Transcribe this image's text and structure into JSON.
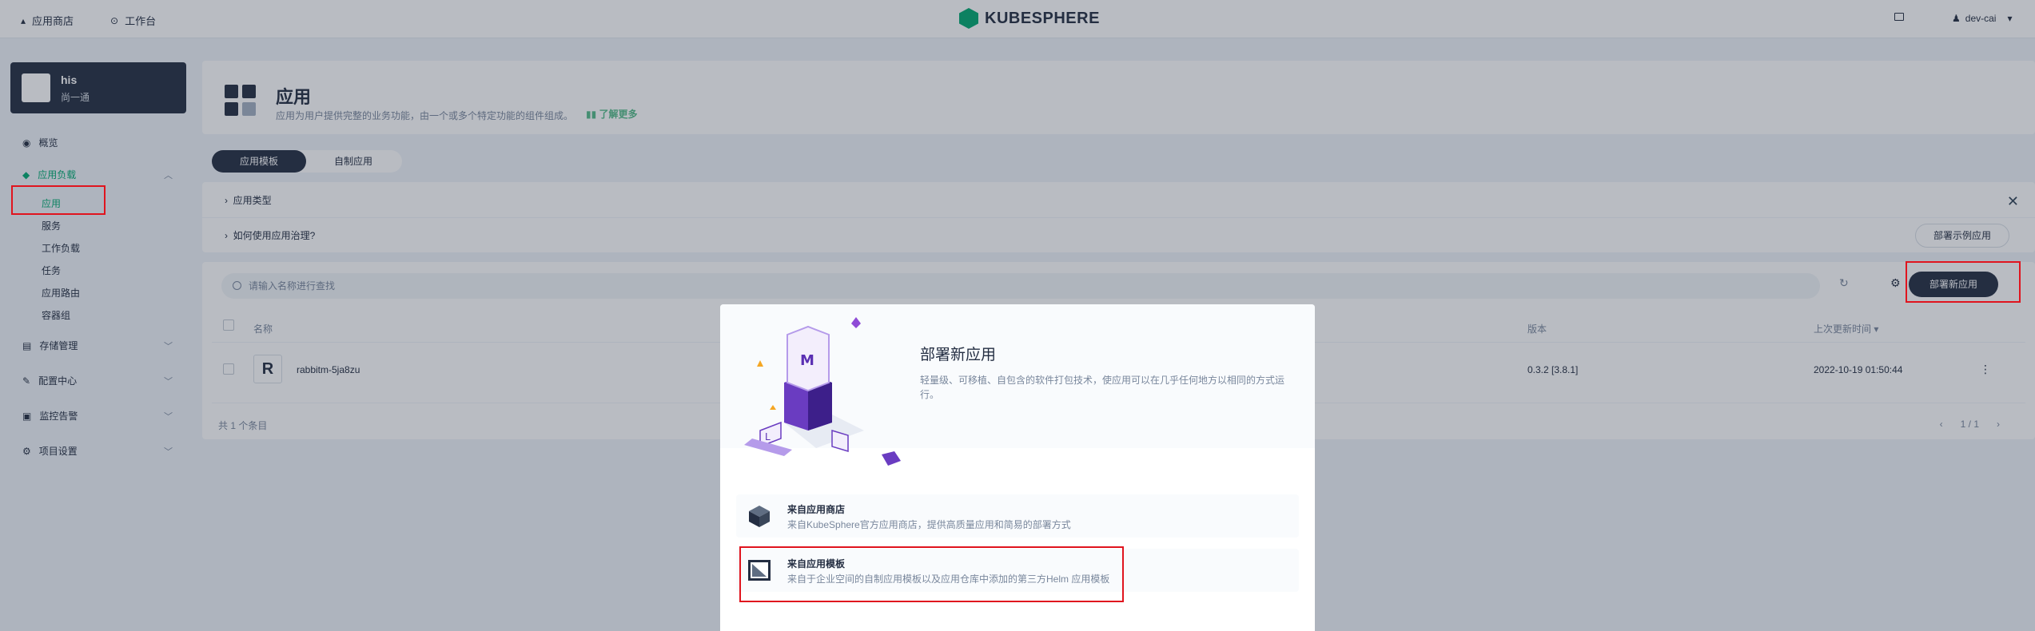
{
  "topbar": {
    "app_store": "应用商店",
    "workbench": "工作台",
    "logo_text": "KUBESPHERE",
    "user": "dev-cai"
  },
  "sidebar": {
    "project_name": "his",
    "project_desc": "尚一通",
    "overview": "概览",
    "app_workloads": "应用负载",
    "sub_items": [
      "应用",
      "服务",
      "工作负载",
      "任务",
      "应用路由",
      "容器组"
    ],
    "storage": "存储管理",
    "config": "配置中心",
    "monitoring": "监控告警",
    "settings": "项目设置"
  },
  "banner": {
    "title": "应用",
    "desc": "应用为用户提供完整的业务功能，由一个或多个特定功能的组件组成。",
    "learn_more": "了解更多"
  },
  "tabs": [
    "应用模板",
    "自制应用"
  ],
  "tips": {
    "row1": "应用类型",
    "row2": "如何使用应用治理?",
    "sample_button": "部署示例应用"
  },
  "toolbar": {
    "search_placeholder": "请输入名称进行查找",
    "deploy_button": "部署新应用"
  },
  "table": {
    "headers": {
      "name": "名称",
      "version": "版本",
      "updated": "上次更新时间"
    },
    "rows": [
      {
        "avatar": "R",
        "name": "rabbitm-5ja8zu",
        "version": "0.3.2 [3.8.1]",
        "updated": "2022-10-19 01:50:44"
      }
    ],
    "total": "共 1 个条目",
    "page": "1 / 1"
  },
  "modal": {
    "title": "部署新应用",
    "desc": "轻量级、可移植、自包含的软件打包技术，使应用可以在几乎任何地方以相同的方式运行。",
    "options": [
      {
        "title": "来自应用商店",
        "desc": "来自KubeSphere官方应用商店，提供高质量应用和简易的部署方式",
        "icon": "cube-icon"
      },
      {
        "title": "来自应用模板",
        "desc": "来自于企业空间的自制应用模板以及应用仓库中添加的第三方Helm 应用模板",
        "icon": "template-icon"
      }
    ]
  },
  "colors": {
    "accent": "#00aa72",
    "dark": "#242e42",
    "highlight": "#e0141e"
  }
}
